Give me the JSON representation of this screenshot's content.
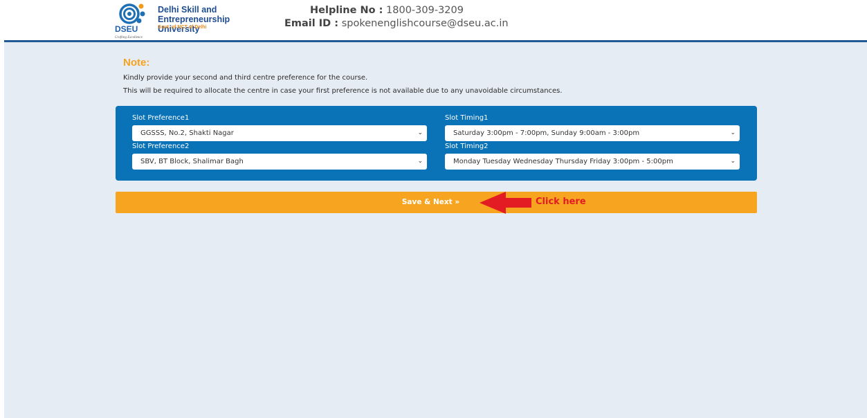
{
  "header": {
    "logo": {
      "name_line1": "Delhi Skill and",
      "name_line2": "Entrepreneurship University",
      "govt": "Govt. of NCT of Delhi",
      "abbr": "DSEU",
      "tagline": "Crafting Excellence"
    },
    "helpline_label": "Helpline No :",
    "helpline_value": "1800-309-3209",
    "email_label": "Email ID :",
    "email_value": "spokenenglishcourse@dseu.ac.in"
  },
  "note": {
    "title": "Note:",
    "line1": "Kindly provide your second and third centre preference for the course.",
    "line2": "This will be required to allocate the centre in case your first preference is not available due to any unavoidable circumstances."
  },
  "form": {
    "slot_pref1_label": "Slot Preference1",
    "slot_pref1_value": "GGSSS, No.2, Shakti Nagar",
    "slot_timing1_label": "Slot Timing1",
    "slot_timing1_value": "Saturday 3:00pm - 7:00pm, Sunday 9:00am - 3:00pm",
    "slot_pref2_label": "Slot Preference2",
    "slot_pref2_value": "SBV, BT Block, Shalimar Bagh",
    "slot_timing2_label": "Slot Timing2",
    "slot_timing2_value": "Monday Tuesday Wednesday Thursday Friday 3:00pm - 5:00pm"
  },
  "actions": {
    "save_next": "Save & Next »",
    "click_here": "Click here"
  },
  "icons": {
    "logo": "dseu-logo-icon",
    "dropdown": "chevron-down-icon",
    "pointer": "red-arrow-icon"
  },
  "colors": {
    "header_rule": "#1f5a96",
    "page_bg": "#e6ecf3",
    "note_title": "#f5a21f",
    "panel": "#0a72b7",
    "save_bar": "#f7a520",
    "callout": "#e31b23"
  }
}
